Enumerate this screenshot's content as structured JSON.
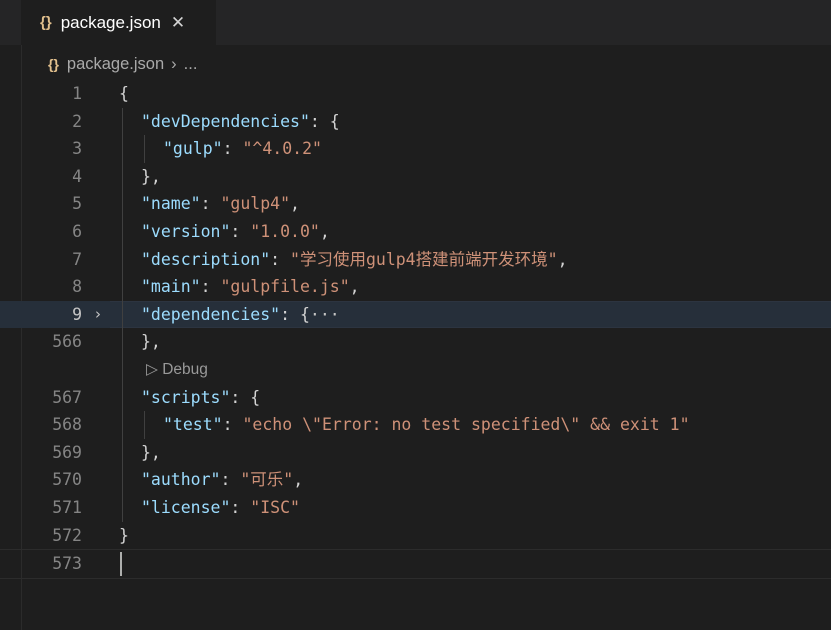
{
  "tab": {
    "icon": "{}",
    "filename": "package.json",
    "close": "✕"
  },
  "breadcrumb": {
    "icon": "{}",
    "file": "package.json",
    "separator": "›",
    "more": "..."
  },
  "codelens": {
    "icon": "▷",
    "label": "Debug"
  },
  "lines": [
    {
      "num": "1",
      "indent": 0,
      "tokens": [
        [
          "p",
          "{"
        ]
      ]
    },
    {
      "num": "2",
      "indent": 1,
      "tokens": [
        [
          "k",
          "\"devDependencies\""
        ],
        [
          "p",
          ": {"
        ]
      ]
    },
    {
      "num": "3",
      "indent": 2,
      "tokens": [
        [
          "k",
          "\"gulp\""
        ],
        [
          "p",
          ": "
        ],
        [
          "s",
          "\"^4.0.2\""
        ]
      ]
    },
    {
      "num": "4",
      "indent": 1,
      "tokens": [
        [
          "p",
          "},"
        ]
      ]
    },
    {
      "num": "5",
      "indent": 1,
      "tokens": [
        [
          "k",
          "\"name\""
        ],
        [
          "p",
          ": "
        ],
        [
          "s",
          "\"gulp4\""
        ],
        [
          "p",
          ","
        ]
      ]
    },
    {
      "num": "6",
      "indent": 1,
      "tokens": [
        [
          "k",
          "\"version\""
        ],
        [
          "p",
          ": "
        ],
        [
          "s",
          "\"1.0.0\""
        ],
        [
          "p",
          ","
        ]
      ]
    },
    {
      "num": "7",
      "indent": 1,
      "tokens": [
        [
          "k",
          "\"description\""
        ],
        [
          "p",
          ": "
        ],
        [
          "s",
          "\"学习使用gulp4搭建前端开发环境\""
        ],
        [
          "p",
          ","
        ]
      ]
    },
    {
      "num": "8",
      "indent": 1,
      "tokens": [
        [
          "k",
          "\"main\""
        ],
        [
          "p",
          ": "
        ],
        [
          "s",
          "\"gulpfile.js\""
        ],
        [
          "p",
          ","
        ]
      ]
    },
    {
      "num": "9",
      "indent": 1,
      "fold": "›",
      "current": true,
      "tokens": [
        [
          "k",
          "\"dependencies\""
        ],
        [
          "p",
          ": {"
        ],
        [
          "collapsed",
          "···"
        ]
      ]
    },
    {
      "num": "566",
      "indent": 1,
      "tokens": [
        [
          "p",
          "},"
        ]
      ]
    },
    {
      "codelens": true
    },
    {
      "num": "567",
      "indent": 1,
      "tokens": [
        [
          "k",
          "\"scripts\""
        ],
        [
          "p",
          ": {"
        ]
      ]
    },
    {
      "num": "568",
      "indent": 2,
      "tokens": [
        [
          "k",
          "\"test\""
        ],
        [
          "p",
          ": "
        ],
        [
          "s",
          "\"echo \\\"Error: no test specified\\\" && exit 1\""
        ]
      ]
    },
    {
      "num": "569",
      "indent": 1,
      "tokens": [
        [
          "p",
          "},"
        ]
      ]
    },
    {
      "num": "570",
      "indent": 1,
      "tokens": [
        [
          "k",
          "\"author\""
        ],
        [
          "p",
          ": "
        ],
        [
          "s",
          "\"可乐\""
        ],
        [
          "p",
          ","
        ]
      ]
    },
    {
      "num": "571",
      "indent": 1,
      "tokens": [
        [
          "k",
          "\"license\""
        ],
        [
          "p",
          ": "
        ],
        [
          "s",
          "\"ISC\""
        ]
      ]
    },
    {
      "num": "572",
      "indent": 0,
      "tokens": [
        [
          "p",
          "}"
        ]
      ]
    },
    {
      "num": "573",
      "indent": 0,
      "cursor": true,
      "tokens": []
    }
  ]
}
